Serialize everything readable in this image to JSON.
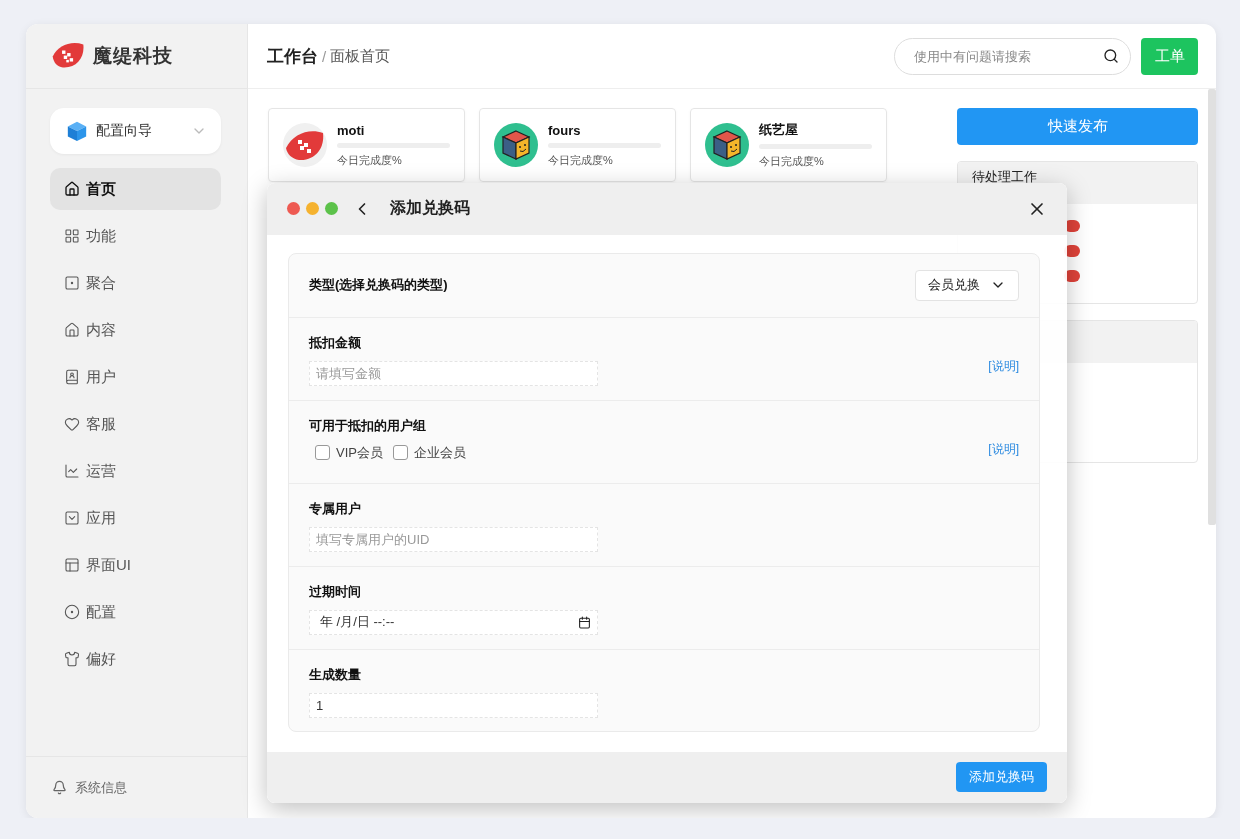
{
  "brand": {
    "name": "魔缇科技"
  },
  "sidebar": {
    "wizard": {
      "label": "配置向导"
    },
    "items": [
      {
        "label": "首页",
        "selected": true
      },
      {
        "label": "功能",
        "selected": false
      },
      {
        "label": "聚合",
        "selected": false
      },
      {
        "label": "内容",
        "selected": false
      },
      {
        "label": "用户",
        "selected": false
      },
      {
        "label": "客服",
        "selected": false
      },
      {
        "label": "运营",
        "selected": false
      },
      {
        "label": "应用",
        "selected": false
      },
      {
        "label": "界面UI",
        "selected": false
      },
      {
        "label": "配置",
        "selected": false
      },
      {
        "label": "偏好",
        "selected": false
      }
    ],
    "footer": {
      "label": "系统信息"
    }
  },
  "header": {
    "title": "工作台",
    "separator": "/",
    "subtitle": "面板首页",
    "search": {
      "placeholder": "使用中有问题请搜索"
    },
    "ticket_button": "工单"
  },
  "cards": [
    {
      "name": "moti",
      "caption": "今日完成度%",
      "level": 0
    },
    {
      "name": "fours",
      "caption": "今日完成度%",
      "level": 0
    },
    {
      "name": "纸艺屋",
      "caption": "今日完成度%",
      "level": 0
    }
  ],
  "quick_publish": "快速发布",
  "panels": [
    {
      "title": "待处理工作"
    }
  ],
  "dialog": {
    "title": "添加兑换码",
    "fields": [
      {
        "kind": "select",
        "label": "类型(选择兑换码的类型)",
        "value": "会员兑换"
      },
      {
        "kind": "text",
        "label": "抵扣金额",
        "placeholder": "请填写金额",
        "help": "[说明]"
      },
      {
        "kind": "checkboxes",
        "label": "可用于抵扣的用户组",
        "options": [
          {
            "label": "VIP会员",
            "checked": false
          },
          {
            "label": "企业会员",
            "checked": false
          }
        ],
        "help": "[说明]"
      },
      {
        "kind": "text",
        "label": "专属用户",
        "placeholder": "填写专属用户的UID"
      },
      {
        "kind": "date",
        "label": "过期时间",
        "value": "年 /月/日 --:--"
      },
      {
        "kind": "text",
        "label": "生成数量",
        "value": "1"
      }
    ],
    "submit": "添加兑换码"
  }
}
